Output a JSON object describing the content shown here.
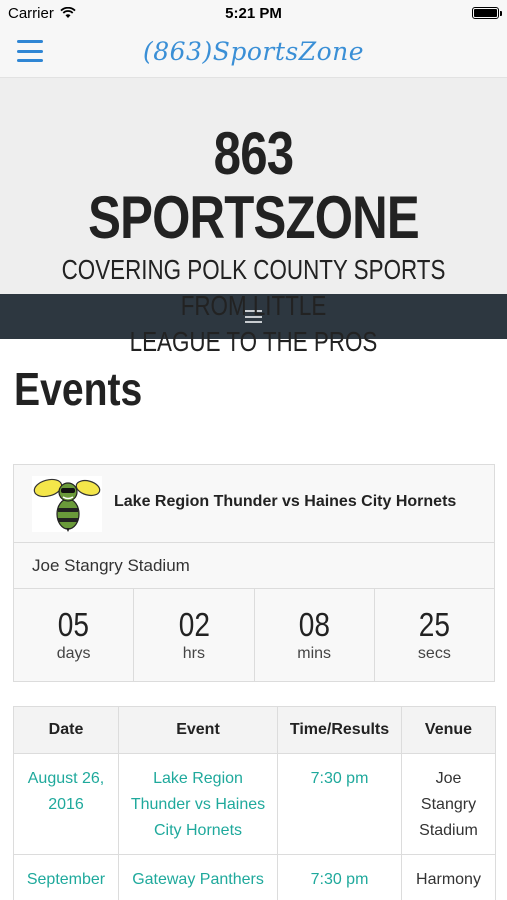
{
  "status_bar": {
    "carrier": "Carrier",
    "time": "5:21 PM",
    "battery_level": 1.0
  },
  "app_bar": {
    "title": "(863)SportsZone",
    "menu_icon": "hamburger-menu-icon"
  },
  "header": {
    "site_title": "863 SPORTSZONE",
    "tagline_line1": "COVERING POLK COUNTY SPORTS FROM LITTLE",
    "tagline_line2": "LEAGUE TO THE PROS"
  },
  "nav": {
    "toggle_icon": "hamburger-menu-icon"
  },
  "main": {
    "heading": "Events"
  },
  "featured_event": {
    "logo_icon": "hornet-mascot-icon",
    "name": "Lake Region Thunder vs Haines City Hornets",
    "venue": "Joe Stangry Stadium",
    "countdown": [
      {
        "value": "05",
        "unit": "days"
      },
      {
        "value": "02",
        "unit": "hrs"
      },
      {
        "value": "08",
        "unit": "mins"
      },
      {
        "value": "25",
        "unit": "secs"
      }
    ]
  },
  "events_table": {
    "headers": [
      "Date",
      "Event",
      "Time/Results",
      "Venue"
    ],
    "rows": [
      {
        "date": "August 26, 2016",
        "event": "Lake Region Thunder vs Haines City Hornets",
        "time": "7:30 pm",
        "venue": "Joe Stangry Stadium"
      },
      {
        "date": "September",
        "event": "Gateway Panthers",
        "time": "7:30 pm",
        "venue": "Harmony"
      }
    ]
  },
  "colors": {
    "link": "#1fa99c",
    "app_title": "#3a8fd6",
    "nav_bg": "#2d3740"
  }
}
